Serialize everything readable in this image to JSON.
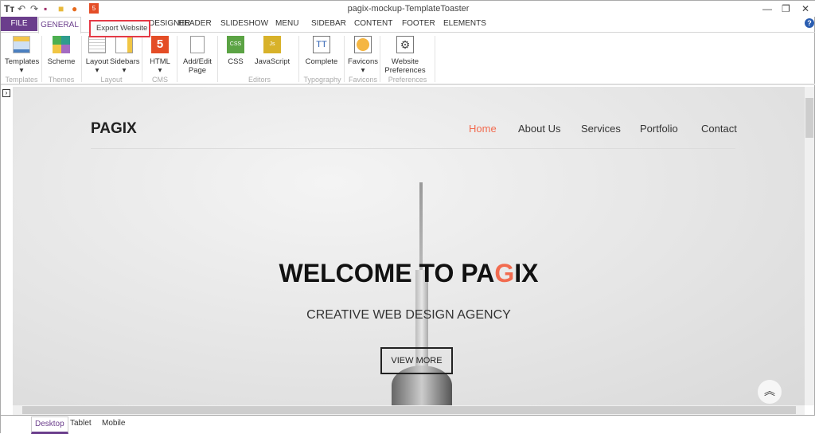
{
  "window": {
    "title": "pagix-mockup-TemplateToaster"
  },
  "tabs": [
    "FILE",
    "GENERAL",
    "DESIGNER",
    "HEADER",
    "SLIDESHOW",
    "MENU",
    "SIDEBAR",
    "CONTENT",
    "FOOTER",
    "ELEMENTS"
  ],
  "tooltip": "Export Website",
  "ribbon": {
    "buttons": [
      "Templates",
      "Scheme",
      "Layout",
      "Sidebars",
      "HTML",
      "Add/Edit Page",
      "CSS",
      "JavaScript",
      "Complete",
      "Favicons",
      "Website Preferences"
    ],
    "groups": [
      "Templates",
      "Themes",
      "Layout",
      "CMS",
      "Editors",
      "Typography",
      "Favicons",
      "Preferences"
    ]
  },
  "site": {
    "logo": "PAGIX",
    "nav": [
      "Home",
      "About Us",
      "Services",
      "Portfolio",
      "Contact"
    ],
    "heading_pre": "WELCOME TO PA",
    "heading_accent": "G",
    "heading_post": "IX",
    "subtitle": "CREATIVE WEB DESIGN AGENCY",
    "cta": "VIEW MORE",
    "accent": "#f26b4f"
  },
  "device_tabs": [
    "Desktop",
    "Tablet",
    "Mobile"
  ],
  "colors": {
    "brand": "#6b3e8c",
    "highlight": "#e53945"
  }
}
